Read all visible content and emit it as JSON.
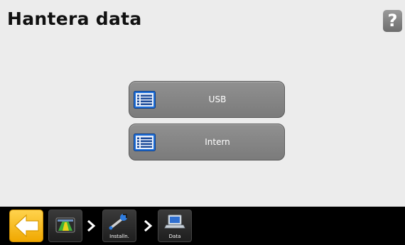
{
  "header": {
    "title": "Hantera data",
    "help_label": "?"
  },
  "menu": {
    "items": [
      {
        "label": "USB",
        "icon": "list-icon"
      },
      {
        "label": "Intern",
        "icon": "list-icon"
      }
    ]
  },
  "breadcrumb": {
    "back_icon": "arrow-left-icon",
    "items": [
      {
        "label": "",
        "icon": "field-view-icon"
      },
      {
        "label": "Installn.",
        "icon": "wrench-icon"
      },
      {
        "label": "Data",
        "icon": "laptop-icon"
      }
    ]
  },
  "colors": {
    "accent": "#f5b800",
    "button_gray": "#858585",
    "background": "#ececec",
    "bar": "#000000"
  }
}
